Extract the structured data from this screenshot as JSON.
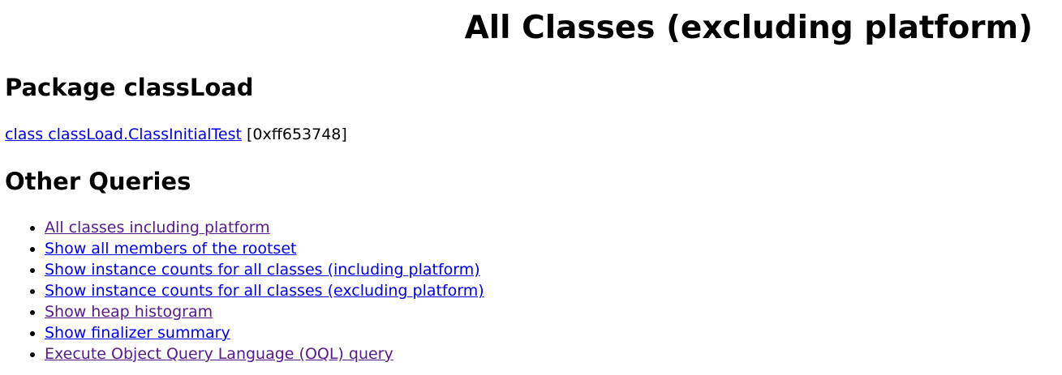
{
  "page": {
    "title": "All Classes (excluding platform)"
  },
  "package_section": {
    "heading": "Package classLoad",
    "classes": [
      {
        "label": "class classLoad.ClassInitialTest",
        "address": "[0xff653748]"
      }
    ]
  },
  "other_queries": {
    "heading": "Other Queries",
    "links": [
      {
        "label": "All classes including platform",
        "visited": true
      },
      {
        "label": "Show all members of the rootset",
        "visited": false
      },
      {
        "label": "Show instance counts for all classes (including platform)",
        "visited": false
      },
      {
        "label": "Show instance counts for all classes (excluding platform)",
        "visited": false
      },
      {
        "label": "Show heap histogram",
        "visited": true
      },
      {
        "label": "Show finalizer summary",
        "visited": false
      },
      {
        "label": "Execute Object Query Language (OQL) query",
        "visited": true
      }
    ]
  },
  "colors": {
    "link": "#0000ee",
    "link_visited": "#551a8b",
    "text": "#000000",
    "background": "#ffffff"
  }
}
